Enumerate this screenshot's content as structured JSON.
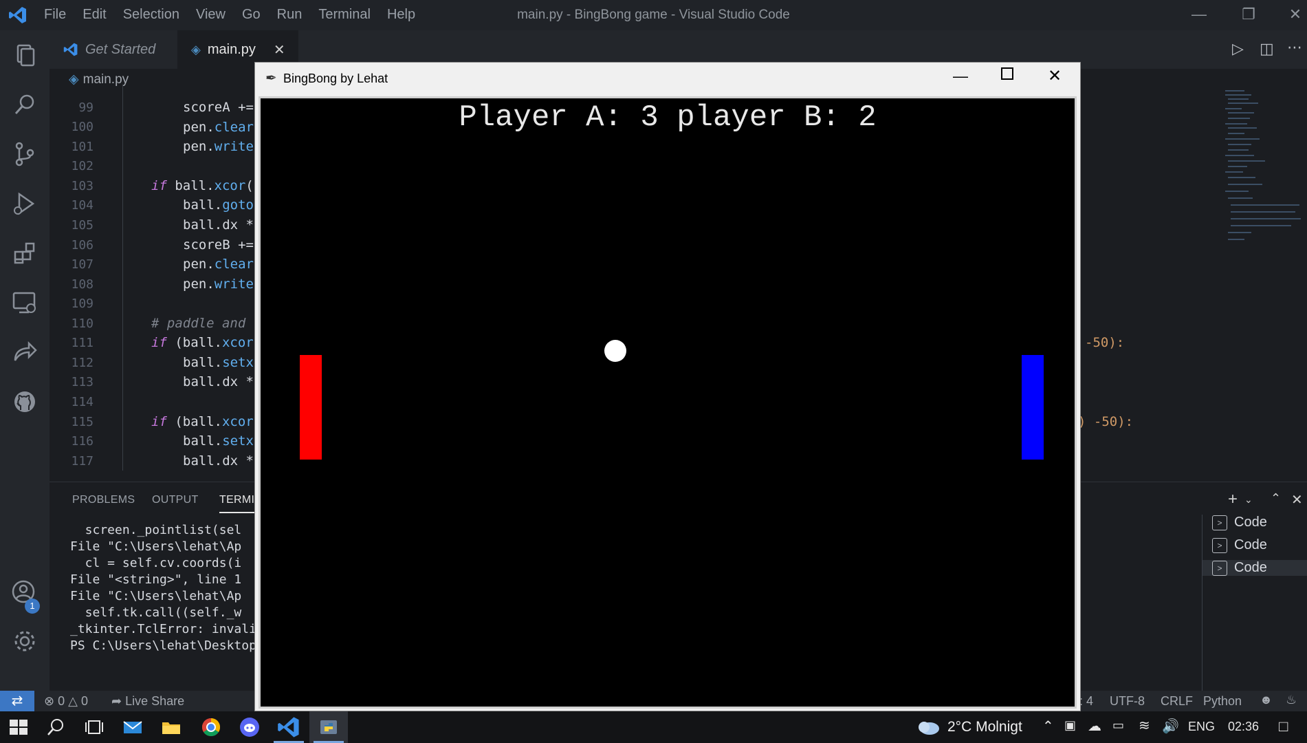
{
  "vscode": {
    "menu": [
      "File",
      "Edit",
      "Selection",
      "View",
      "Go",
      "Run",
      "Terminal",
      "Help"
    ],
    "window_title": "main.py - BingBong game - Visual Studio Code",
    "tabs": [
      {
        "label": "Get Started"
      },
      {
        "label": "main.py"
      }
    ],
    "breadcrumb": "main.py",
    "line_numbers": [
      "99",
      "100",
      "101",
      "102",
      "103",
      "104",
      "105",
      "106",
      "107",
      "108",
      "109",
      "110",
      "111",
      "112",
      "113",
      "114",
      "115",
      "116",
      "117"
    ],
    "code_tail_111": "-50):",
    "code_tail_115": ") -50):",
    "panel_tabs": [
      "PROBLEMS",
      "OUTPUT",
      "TERMIN"
    ],
    "terminal_lines": [
      "  screen._pointlist(sel",
      "File \"C:\\Users\\lehat\\Ap",
      "  cl = self.cv.coords(i",
      "File \"<string>\", line 1",
      "File \"C:\\Users\\lehat\\Ap",
      "  self.tk.call((self._w",
      "_tkinter.TclError: invali",
      "PS C:\\Users\\lehat\\Desktop"
    ],
    "terminal_list": [
      "Code",
      "Code",
      "Code"
    ],
    "account_badge": "1",
    "status": {
      "errors": "0",
      "warnings": "0",
      "live_share": "Live Share",
      "col": ": 4",
      "encoding": "UTF-8",
      "eol": "CRLF",
      "language": "Python"
    }
  },
  "game_window": {
    "title": "BingBong by Lehat",
    "score_text": "Player A: 3  player B: 2",
    "paddle_a_color": "#ff0000",
    "paddle_b_color": "#0000ff",
    "ball_color": "#ffffff",
    "background": "#000000"
  },
  "taskbar": {
    "weather": "2°C  Molnigt",
    "language": "ENG",
    "time": "02:36"
  }
}
